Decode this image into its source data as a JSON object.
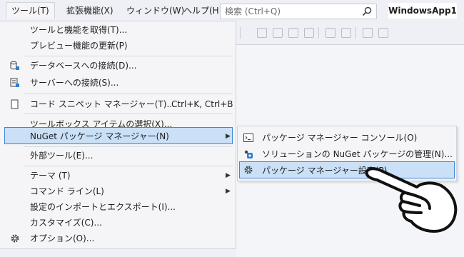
{
  "menubar": {
    "items": [
      {
        "label": "ツール(T)"
      },
      {
        "label": "拡張機能(X)"
      },
      {
        "label": "ウィンドウ(W)"
      },
      {
        "label": "ヘルプ(H)"
      }
    ],
    "search_placeholder": "検索 (Ctrl+Q)",
    "app_title": "WindowsApp1"
  },
  "tools_menu": {
    "items": [
      {
        "label": "ツールと機能を取得(T)..."
      },
      {
        "label": "プレビュー機能の更新(P)"
      },
      {
        "label": "データベースへの接続(D)..."
      },
      {
        "label": "サーバーへの接続(S)..."
      },
      {
        "label": "コード スニペット マネージャー(T)...",
        "shortcut": "Ctrl+K, Ctrl+B"
      },
      {
        "label": "ツールボックス アイテムの選択(X)..."
      },
      {
        "label": "NuGet パッケージ マネージャー(N)"
      },
      {
        "label": "外部ツール(E)..."
      },
      {
        "label": "テーマ (T)"
      },
      {
        "label": "コマンド ライン(L)"
      },
      {
        "label": "設定のインポートとエクスポート(I)..."
      },
      {
        "label": "カスタマイズ(C)..."
      },
      {
        "label": "オプション(O)..."
      }
    ]
  },
  "nuget_submenu": {
    "items": [
      {
        "label": "パッケージ マネージャー コンソール(O)"
      },
      {
        "label": "ソリューションの NuGet パッケージの管理(N)..."
      },
      {
        "label": "パッケージ マネージャー設定(P)"
      }
    ]
  },
  "colors": {
    "highlight_bg": "#c9e0f7",
    "highlight_border": "#3d86d8",
    "menu_bg": "#f5f5f7",
    "chrome_bg": "#eef0f6"
  }
}
